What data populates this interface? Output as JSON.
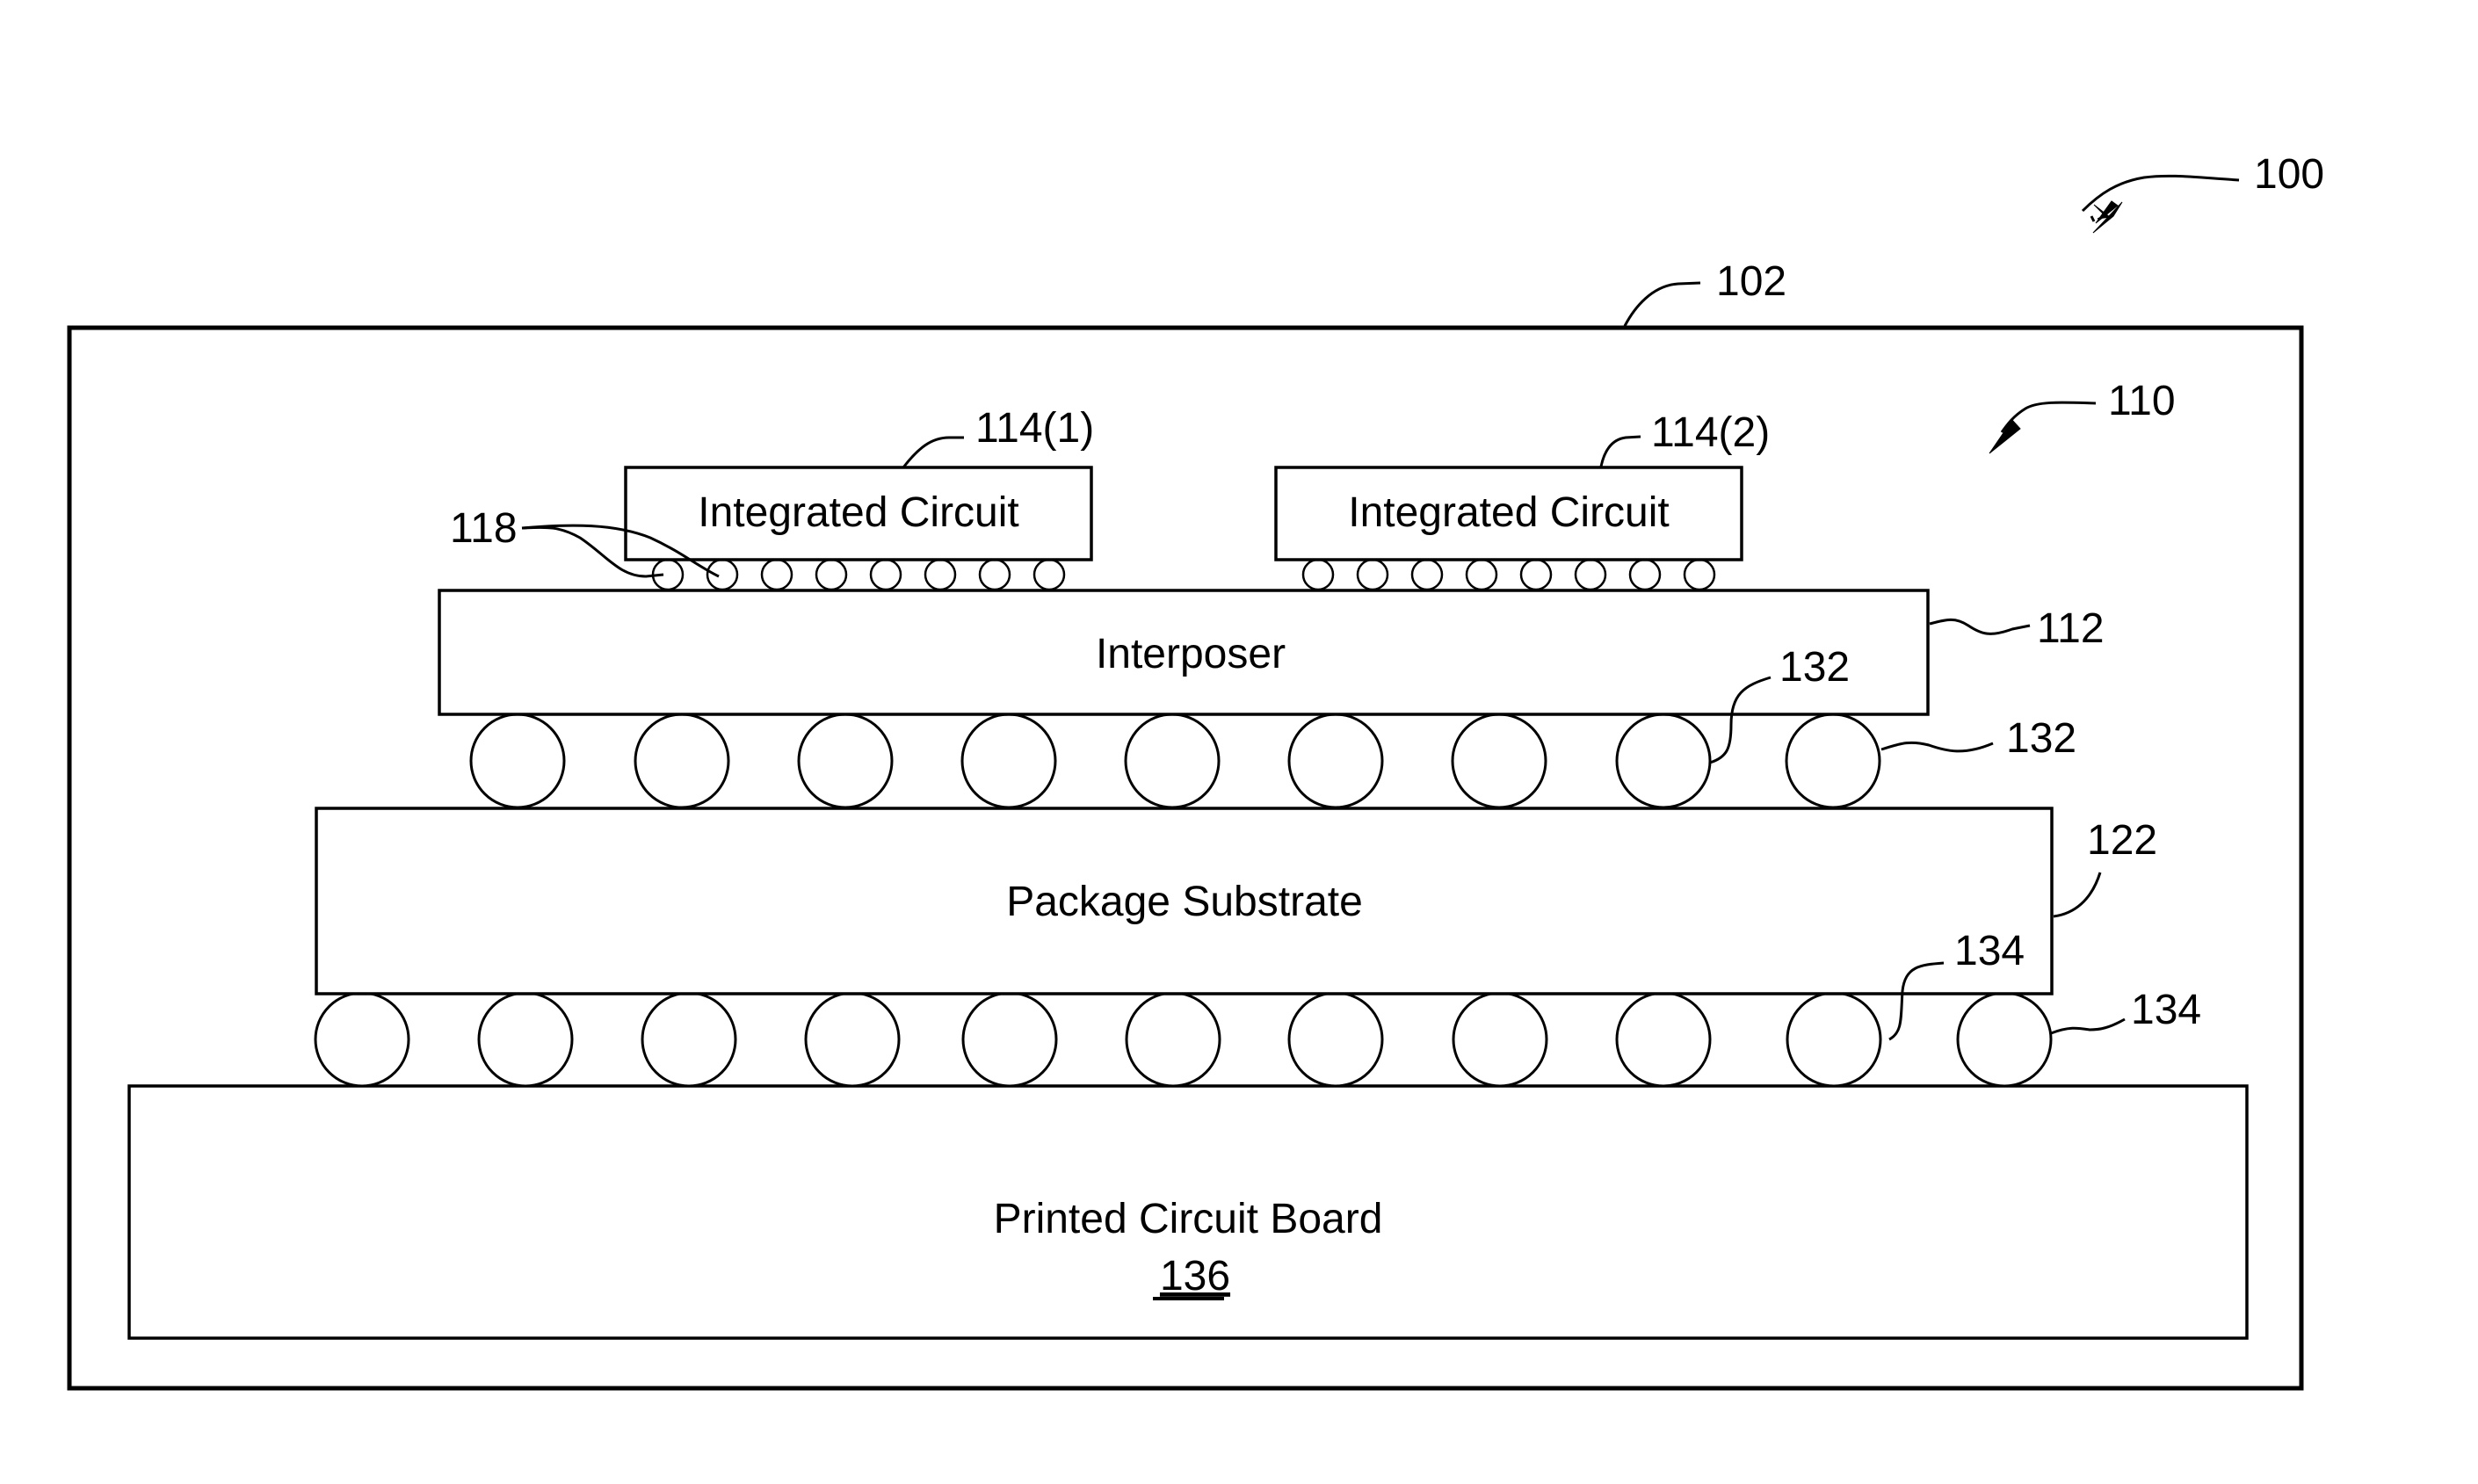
{
  "figure": {
    "system_ref": "100",
    "enclosure_ref": "102",
    "package_ref": "110"
  },
  "components": {
    "ic1": {
      "label": "Integrated Circuit",
      "ref": "114(1)",
      "bump_count": 8
    },
    "ic2": {
      "label": "Integrated Circuit",
      "ref": "114(2)",
      "bump_count": 8
    },
    "microbumps": {
      "ref": "118"
    },
    "interposer": {
      "label": "Interposer",
      "ref": "112"
    },
    "interposer_balls": {
      "ref_inner": "132",
      "ref_outer": "132",
      "ball_count": 9
    },
    "package_substrate": {
      "label": "Package Substrate",
      "ref": "122"
    },
    "substrate_balls": {
      "ref_inner": "134",
      "ref_outer": "134",
      "ball_count": 11
    },
    "pcb": {
      "label": "Printed Circuit Board",
      "ref": "136"
    }
  }
}
